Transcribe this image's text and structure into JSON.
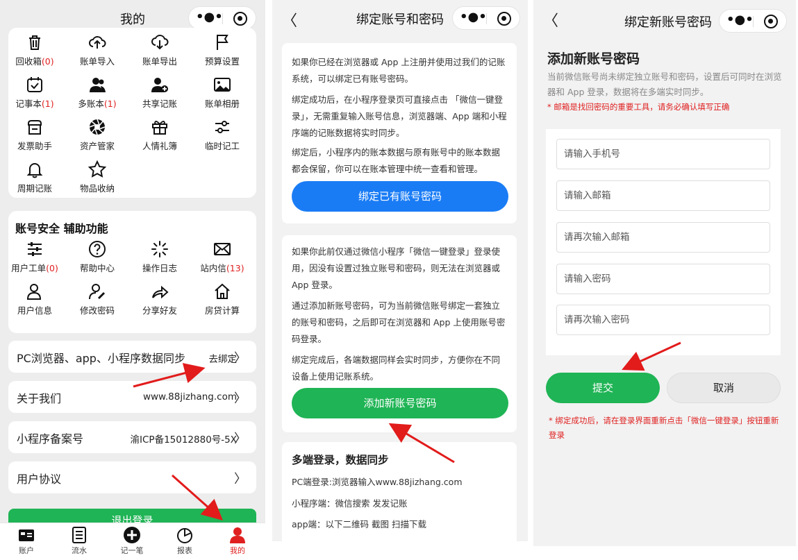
{
  "screen1": {
    "title": "我的",
    "grid1": [
      {
        "icon": "trash-icon",
        "label": "回收箱",
        "count": "(0)"
      },
      {
        "icon": "cloud-upload-icon",
        "label": "账单导入",
        "count": ""
      },
      {
        "icon": "cloud-download-icon",
        "label": "账单导出",
        "count": ""
      },
      {
        "icon": "flag-icon",
        "label": "预算设置",
        "count": ""
      },
      {
        "icon": "calendar-check-icon",
        "label": "记事本",
        "count": "(1)"
      },
      {
        "icon": "users-icon",
        "label": "多账本",
        "count": "(1)"
      },
      {
        "icon": "user-plus-icon",
        "label": "共享记账",
        "count": ""
      },
      {
        "icon": "image-icon",
        "label": "账单相册",
        "count": ""
      },
      {
        "icon": "invoice-icon",
        "label": "发票助手",
        "count": ""
      },
      {
        "icon": "aperture-icon",
        "label": "资产管家",
        "count": ""
      },
      {
        "icon": "gift-icon",
        "label": "人情礼簿",
        "count": ""
      },
      {
        "icon": "sliders-icon",
        "label": "临时记工",
        "count": ""
      },
      {
        "icon": "bell-icon",
        "label": "周期记账",
        "count": ""
      },
      {
        "icon": "star-icon",
        "label": "物品收纳",
        "count": ""
      }
    ],
    "section2_title": "账号安全  辅助功能",
    "grid2": [
      {
        "icon": "settings-sliders-icon",
        "label": "用户工单",
        "count": "(0)"
      },
      {
        "icon": "help-icon",
        "label": "帮助中心",
        "count": ""
      },
      {
        "icon": "spinner-icon",
        "label": "操作日志",
        "count": ""
      },
      {
        "icon": "mail-icon",
        "label": "站内信",
        "count": "(13)"
      },
      {
        "icon": "user-icon",
        "label": "用户信息",
        "count": ""
      },
      {
        "icon": "user-edit-icon",
        "label": "修改密码",
        "count": ""
      },
      {
        "icon": "share-icon",
        "label": "分享好友",
        "count": ""
      },
      {
        "icon": "home-icon",
        "label": "房贷计算",
        "count": ""
      }
    ],
    "rows": [
      {
        "label": "PC浏览器、app、小程序数据同步",
        "value": "去绑定"
      },
      {
        "label": "关于我们",
        "value": "www.88jizhang.com"
      },
      {
        "label": "小程序备案号",
        "value": "渝ICP备15012880号-5X"
      },
      {
        "label": "用户协议",
        "value": ""
      }
    ],
    "logout": "退出登录",
    "tabs": [
      {
        "icon": "account-card-icon",
        "label": "账户"
      },
      {
        "icon": "list-icon",
        "label": "流水"
      },
      {
        "icon": "plus-circle-icon",
        "label": "记一笔"
      },
      {
        "icon": "pie-chart-icon",
        "label": "报表"
      },
      {
        "icon": "person-icon",
        "label": "我的"
      }
    ],
    "active_tab_color": "#e02020"
  },
  "screen2": {
    "title": "绑定账号和密码",
    "card1": {
      "p1": "如果你已经在浏览器或 App 上注册并使用过我们的记账系统，可以绑定已有账号密码。",
      "p2": "绑定成功后，在小程序登录页可直接点击 「微信一键登录」，无需重复输入账号信息，浏览器端、App 端和小程序端的记账数据将实时同步。",
      "p3": "绑定后，小程序内的账本数据与原有账号中的账本数据都会保留，你可以在账本管理中统一查看和管理。",
      "button": "绑定已有账号密码"
    },
    "card2": {
      "p1": "如果你此前仅通过微信小程序「微信一键登录」登录使用，因没有设置过独立账号和密码，则无法在浏览器或 App 登录。",
      "p2": "通过添加新账号密码，可为当前微信账号绑定一套独立的账号和密码，之后即可在浏览器和 App 上使用账号密码登录。",
      "p3": "绑定完成后，各端数据同样会实时同步，方便你在不同设备上使用记账系统。",
      "button": "添加新账号密码"
    },
    "card3": {
      "title": "多端登录，数据同步",
      "l1": "PC端登录:浏览器输入www.88jizhang.com",
      "l2": "小程序端：微信搜索 发发记账",
      "l3": "app端：以下二维码 截图 扫描下载"
    }
  },
  "screen3": {
    "title": "绑定新账号密码",
    "heading": "添加新账号密码",
    "desc": "当前微信账号尚未绑定独立账号和密码，设置后可同时在浏览器和 App 登录，数据将在多端实时同步。",
    "warning": "* 邮箱是找回密码的重要工具，请务必确认填写正确",
    "fields": [
      {
        "placeholder": "请输入手机号"
      },
      {
        "placeholder": "请输入邮箱"
      },
      {
        "placeholder": "请再次输入邮箱"
      },
      {
        "placeholder": "请输入密码"
      },
      {
        "placeholder": "请再次输入密码"
      }
    ],
    "submit": "提交",
    "cancel": "取消",
    "note": "* 绑定成功后，请在登录界面重新点击「微信一键登录」按钮重新登录"
  },
  "colors": {
    "green": "#1fb455",
    "blue": "#1a7cf5",
    "red": "#e02020",
    "arrow": "#e21b1b"
  }
}
